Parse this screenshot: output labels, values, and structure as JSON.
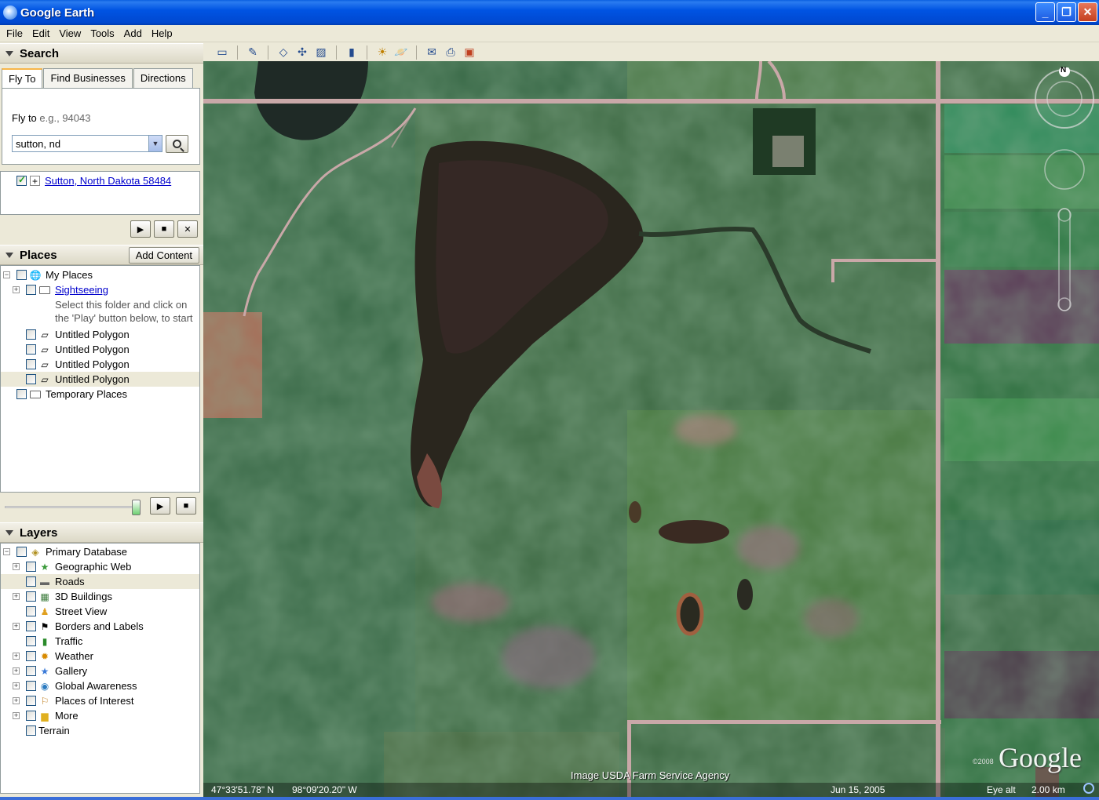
{
  "window": {
    "title": "Google Earth",
    "minimize": "_",
    "maximize": "❐",
    "close": "✕"
  },
  "menu": [
    "File",
    "Edit",
    "View",
    "Tools",
    "Add",
    "Help"
  ],
  "search": {
    "header": "Search",
    "tabs": [
      "Fly To",
      "Find Businesses",
      "Directions"
    ],
    "flyto_label": "Fly to",
    "flyto_hint": "e.g., 94043",
    "flyto_value": "sutton, nd",
    "result": "Sutton, North Dakota 58484"
  },
  "places": {
    "header": "Places",
    "add_content": "Add Content",
    "items": [
      {
        "label": "My Places"
      },
      {
        "label": "Sightseeing"
      },
      {
        "label": "Select this folder and click on"
      },
      {
        "label": "the 'Play' button below, to start"
      },
      {
        "label": "Untitled Polygon"
      },
      {
        "label": "Untitled Polygon"
      },
      {
        "label": "Untitled Polygon"
      },
      {
        "label": "Untitled Polygon"
      },
      {
        "label": "Temporary Places"
      }
    ]
  },
  "layers": {
    "header": "Layers",
    "items": [
      {
        "label": "Primary Database"
      },
      {
        "label": "Geographic Web"
      },
      {
        "label": "Roads"
      },
      {
        "label": "3D Buildings"
      },
      {
        "label": "Street View"
      },
      {
        "label": "Borders and Labels"
      },
      {
        "label": "Traffic"
      },
      {
        "label": "Weather"
      },
      {
        "label": "Gallery"
      },
      {
        "label": "Global Awareness"
      },
      {
        "label": "Places of Interest"
      },
      {
        "label": "More"
      },
      {
        "label": "Terrain"
      }
    ]
  },
  "map": {
    "lat": "47°33'51.78\" N",
    "lon": "98°09'20.20\" W",
    "credit": "Image USDA Farm Service Agency",
    "date": "Jun 15, 2005",
    "eye_alt_label": "Eye alt",
    "eye_alt_value": "2.00 km",
    "logo": "Google",
    "copyright": "©2008",
    "compass_north": "N"
  },
  "colors": {
    "titlebar": "#0054E3",
    "road": "#c9a8a8",
    "vegetation": "#3f6b45",
    "water": "#2a261e"
  }
}
